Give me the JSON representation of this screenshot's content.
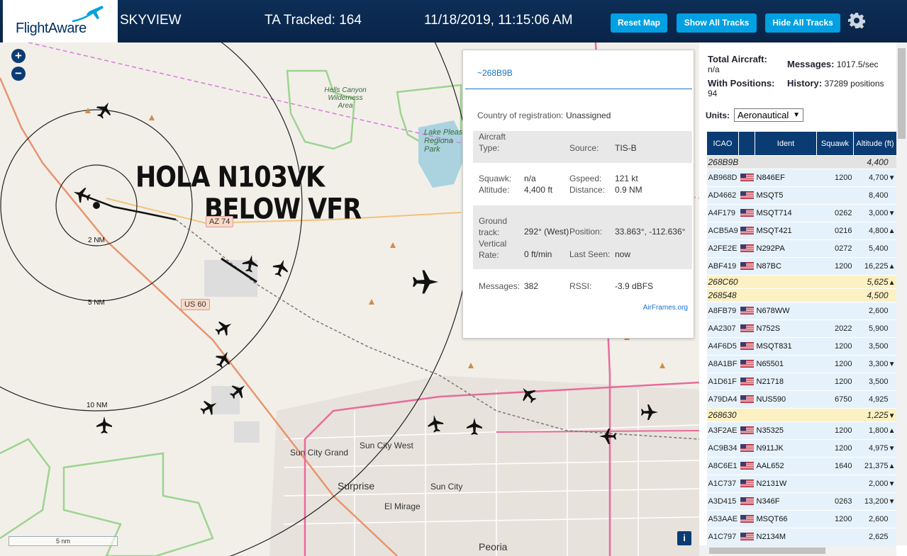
{
  "header": {
    "logo_text": "FlightAware",
    "title": "SKYVIEW",
    "tracked": "TA Tracked: 164",
    "datetime": "11/18/2019, 11:15:06 AM",
    "buttons": {
      "reset": "Reset Map",
      "show_all": "Show All Tracks",
      "hide_all": "Hide All Tracks"
    },
    "colors": {
      "bar": "#0c2e57",
      "button": "#00a0e2"
    }
  },
  "map": {
    "zoom_in": "+",
    "zoom_out": "−",
    "annotation_line1": "HOLA N103VK",
    "annotation_line2": "BELOW VFR",
    "ring_labels": [
      "2 NM",
      "5 NM",
      "10 NM"
    ],
    "places": {
      "hells_canyon": "Hells Canyon Wilderness Area",
      "lake_pleasant": "Lake Pleas Regiona Park",
      "sun_city_grand": "Sun City Grand",
      "sun_city_west": "Sun City West",
      "surprise": "Surprise",
      "sun_city": "Sun City",
      "el_mirage": "El Mirage",
      "peoria": "Peoria"
    },
    "routes": {
      "az74": "AZ 74",
      "us60": "US 60"
    },
    "scale_label": "5 nm",
    "info_button": "i"
  },
  "popup": {
    "hex": "~268B9B",
    "country_label": "Country of registration:",
    "country_value": "Unassigned",
    "aircraft_type_label": "Aircraft Type:",
    "aircraft_type_value": "",
    "source_label": "Source:",
    "source_value": "TIS-B",
    "squawk_label": "Squawk:",
    "squawk_value": "n/a",
    "altitude_label": "Altitude:",
    "altitude_value": "4,400 ft",
    "gspeed_label": "Gspeed:",
    "gspeed_value": "121 kt",
    "distance_label": "Distance:",
    "distance_value": "0.9 NM",
    "ground_track_label": "Ground track:",
    "ground_track_value": "292° (West)",
    "position_label": "Position:",
    "position_value": "33.863°, -112.636°",
    "vrate_label": "Vertical Rate:",
    "vrate_value": "0 ft/min",
    "last_seen_label": "Last Seen:",
    "last_seen_value": "now",
    "messages_label": "Messages:",
    "messages_value": "382",
    "rssi_label": "RSSI:",
    "rssi_value": "-3.9 dBFS",
    "airframes_link": "AirFrames.org"
  },
  "panel": {
    "total_label": "Total Aircraft:",
    "total_value": "n/a",
    "messages_label": "Messages:",
    "messages_value": "1017.5/sec",
    "with_pos_label": "With Positions:",
    "with_pos_value": "94",
    "history_label": "History:",
    "history_value": "37289 positions",
    "units_label": "Units:",
    "units_value": "Aeronautical",
    "columns": {
      "icao": "ICAO",
      "ident": "Ident",
      "squawk": "Squawk",
      "altitude": "Altitude (ft)"
    },
    "rows": [
      {
        "icao": "268B9B",
        "flag": false,
        "ident": "",
        "squawk": "",
        "alt": "4,400",
        "trend": "",
        "style": "g"
      },
      {
        "icao": "AB968D",
        "flag": true,
        "ident": "N846EF",
        "squawk": "1200",
        "alt": "4,700",
        "trend": "▼",
        "style": "r"
      },
      {
        "icao": "AD4662",
        "flag": true,
        "ident": "MSQT5",
        "squawk": "",
        "alt": "8,400",
        "trend": "",
        "style": "r"
      },
      {
        "icao": "A4F179",
        "flag": true,
        "ident": "MSQT714",
        "squawk": "0262",
        "alt": "3,000",
        "trend": "▼",
        "style": "r"
      },
      {
        "icao": "ACB5A9",
        "flag": true,
        "ident": "MSQT421",
        "squawk": "0216",
        "alt": "4,800",
        "trend": "▲",
        "style": "r"
      },
      {
        "icao": "A2FE2E",
        "flag": true,
        "ident": "N292PA",
        "squawk": "0272",
        "alt": "5,400",
        "trend": "",
        "style": "r"
      },
      {
        "icao": "ABF419",
        "flag": true,
        "ident": "N87BC",
        "squawk": "1200",
        "alt": "16,225",
        "trend": "▲",
        "style": "r"
      },
      {
        "icao": "268C60",
        "flag": false,
        "ident": "",
        "squawk": "",
        "alt": "5,625",
        "trend": "▲",
        "style": "y"
      },
      {
        "icao": "268548",
        "flag": false,
        "ident": "",
        "squawk": "",
        "alt": "4,500",
        "trend": "",
        "style": "y"
      },
      {
        "icao": "A8FB79",
        "flag": true,
        "ident": "N678WW",
        "squawk": "",
        "alt": "2,600",
        "trend": "",
        "style": "r"
      },
      {
        "icao": "AA2307",
        "flag": true,
        "ident": "N752S",
        "squawk": "2022",
        "alt": "5,900",
        "trend": "",
        "style": "r"
      },
      {
        "icao": "A4F6D5",
        "flag": true,
        "ident": "MSQT831",
        "squawk": "1200",
        "alt": "3,500",
        "trend": "",
        "style": "r"
      },
      {
        "icao": "A8A1BF",
        "flag": true,
        "ident": "N65501",
        "squawk": "1200",
        "alt": "3,300",
        "trend": "▼",
        "style": "r"
      },
      {
        "icao": "A1D61F",
        "flag": true,
        "ident": "N21718",
        "squawk": "1200",
        "alt": "3,500",
        "trend": "",
        "style": "r"
      },
      {
        "icao": "A79DA4",
        "flag": true,
        "ident": "NUS590",
        "squawk": "6750",
        "alt": "4,925",
        "trend": "",
        "style": "r"
      },
      {
        "icao": "268630",
        "flag": false,
        "ident": "",
        "squawk": "",
        "alt": "1,225",
        "trend": "▼",
        "style": "y"
      },
      {
        "icao": "A3F2AE",
        "flag": true,
        "ident": "N35325",
        "squawk": "1200",
        "alt": "1,800",
        "trend": "▲",
        "style": "r"
      },
      {
        "icao": "AC9B34",
        "flag": true,
        "ident": "N911JK",
        "squawk": "1200",
        "alt": "4,975",
        "trend": "▼",
        "style": "r"
      },
      {
        "icao": "A8C6E1",
        "flag": true,
        "ident": "AAL652",
        "squawk": "1640",
        "alt": "21,375",
        "trend": "▲",
        "style": "r"
      },
      {
        "icao": "A1C737",
        "flag": true,
        "ident": "N2131W",
        "squawk": "",
        "alt": "2,000",
        "trend": "▼",
        "style": "r"
      },
      {
        "icao": "A3D415",
        "flag": true,
        "ident": "N346F",
        "squawk": "0263",
        "alt": "13,200",
        "trend": "▼",
        "style": "r"
      },
      {
        "icao": "A53AAE",
        "flag": true,
        "ident": "MSQT66",
        "squawk": "1200",
        "alt": "2,600",
        "trend": "",
        "style": "r"
      },
      {
        "icao": "A1C797",
        "flag": true,
        "ident": "N2134M",
        "squawk": "",
        "alt": "2,625",
        "trend": "",
        "style": "r"
      }
    ]
  }
}
